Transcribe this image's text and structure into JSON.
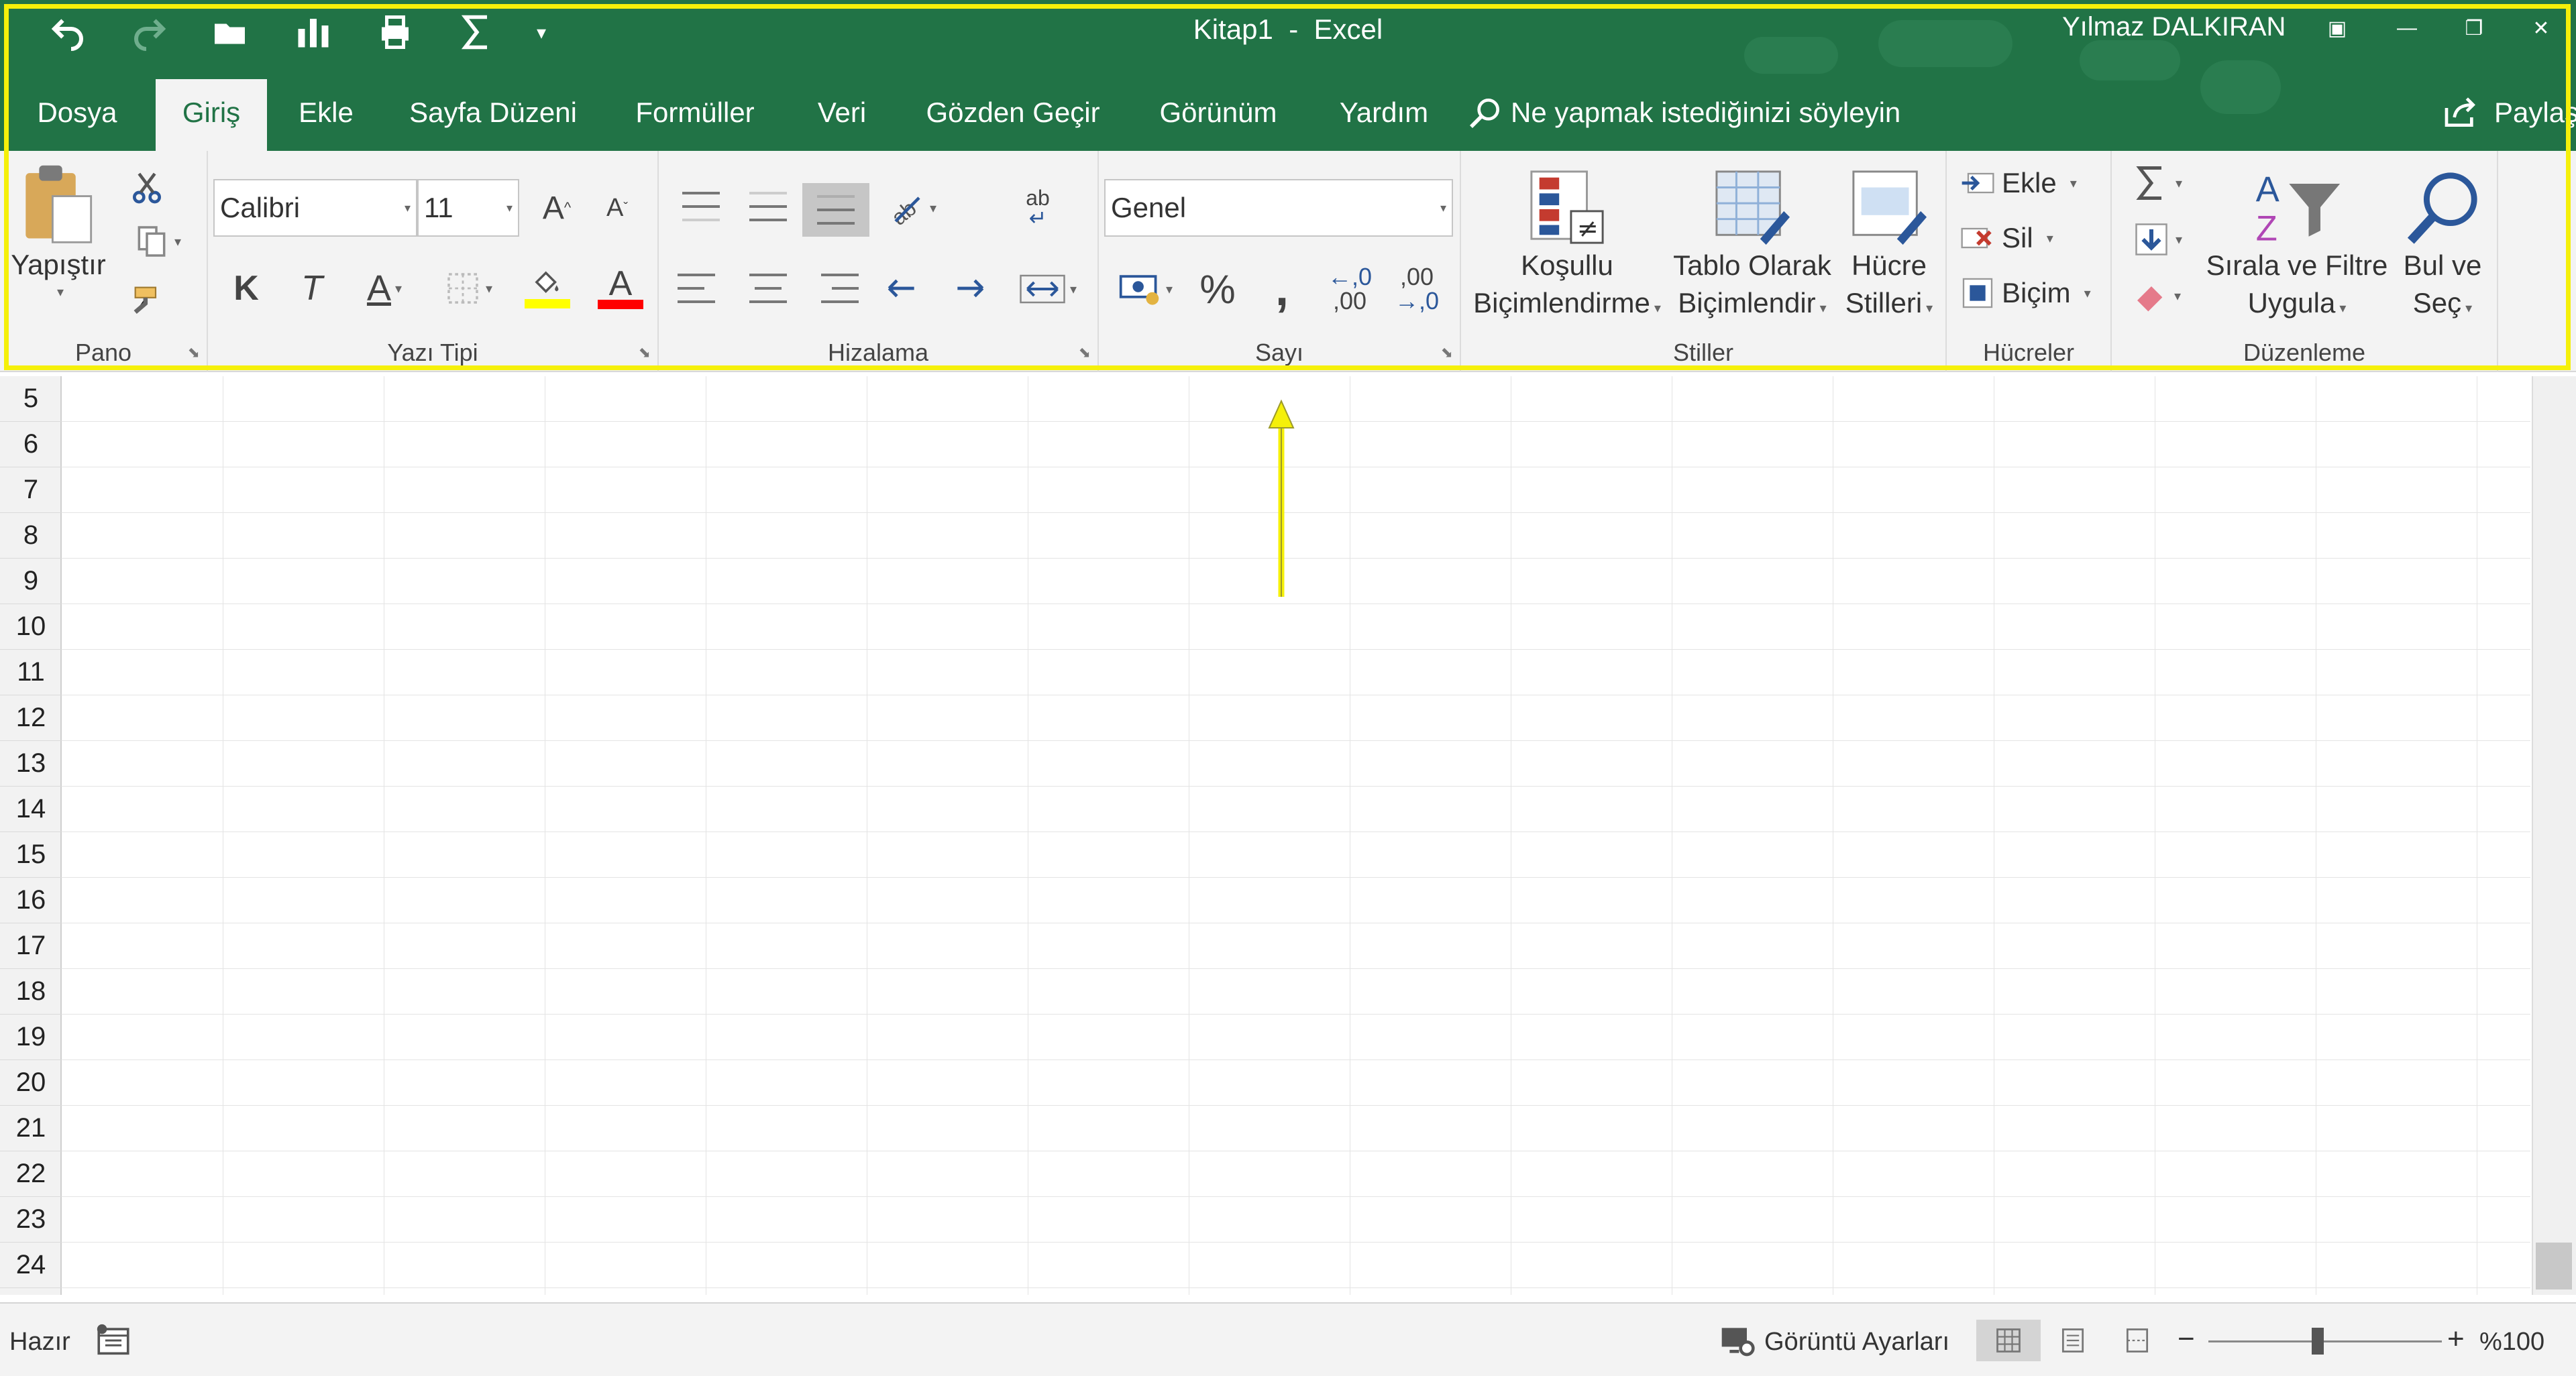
{
  "window": {
    "title": "Kitap1  -  Excel",
    "user": "Yılmaz DALKIRAN"
  },
  "qat": {
    "items": [
      "undo-icon",
      "redo-icon",
      "open-icon",
      "chart-icon",
      "print-preview-icon",
      "autosum-icon",
      "customize-icon"
    ]
  },
  "tabs": [
    {
      "label": "Dosya"
    },
    {
      "label": "Giriş"
    },
    {
      "label": "Ekle"
    },
    {
      "label": "Sayfa Düzeni"
    },
    {
      "label": "Formüller"
    },
    {
      "label": "Veri"
    },
    {
      "label": "Gözden Geçir"
    },
    {
      "label": "Görünüm"
    },
    {
      "label": "Yardım"
    }
  ],
  "tell_me": "Ne yapmak istediğinizi söyleyin",
  "share": "Paylaş",
  "ribbon": {
    "clipboard": {
      "label": "Pano",
      "paste": "Yapıştır"
    },
    "font": {
      "label": "Yazı Tipi",
      "name": "Calibri",
      "size": "11",
      "bold": "K",
      "italic": "T",
      "underline": "A",
      "font_color": "A",
      "grow": "A",
      "shrink": "A",
      "highlight_color": "#ffff00",
      "text_color": "#ff0000"
    },
    "alignment": {
      "label": "Hizalama",
      "wrap": "ab"
    },
    "number": {
      "label": "Sayı",
      "format": "Genel",
      "percent": "%",
      "comma": ",",
      "inc_decimal_top": "←,0",
      "inc_decimal_bottom": ",00",
      "dec_decimal_top": ",00",
      "dec_decimal_bottom": "→,0"
    },
    "styles": {
      "label": "Stiller",
      "conditional_1": "Koşullu",
      "conditional_2": "Biçimlendirme",
      "table_1": "Tablo Olarak",
      "table_2": "Biçimlendir",
      "cell_1": "Hücre",
      "cell_2": "Stilleri"
    },
    "cells": {
      "label": "Hücreler",
      "insert": "Ekle",
      "delete": "Sil",
      "format": "Biçim"
    },
    "editing": {
      "label": "Düzenleme",
      "sort_1": "Sırala ve Filtre",
      "sort_2": "Uygula",
      "find_1": "Bul ve",
      "find_2": "Seç",
      "sort_a": "A",
      "sort_z": "Z"
    }
  },
  "grid": {
    "rows": [
      "5",
      "6",
      "7",
      "8",
      "9",
      "10",
      "11",
      "12",
      "13",
      "14",
      "15",
      "16",
      "17",
      "18",
      "19",
      "20",
      "21",
      "22",
      "23",
      "24"
    ]
  },
  "status": {
    "ready": "Hazır",
    "display_settings": "Görüntü Ayarları",
    "zoom_label": "%100",
    "zoom_minus": "−",
    "zoom_plus": "+"
  },
  "colors": {
    "accent": "#217346",
    "highlight_frame": "#f5f00a"
  }
}
